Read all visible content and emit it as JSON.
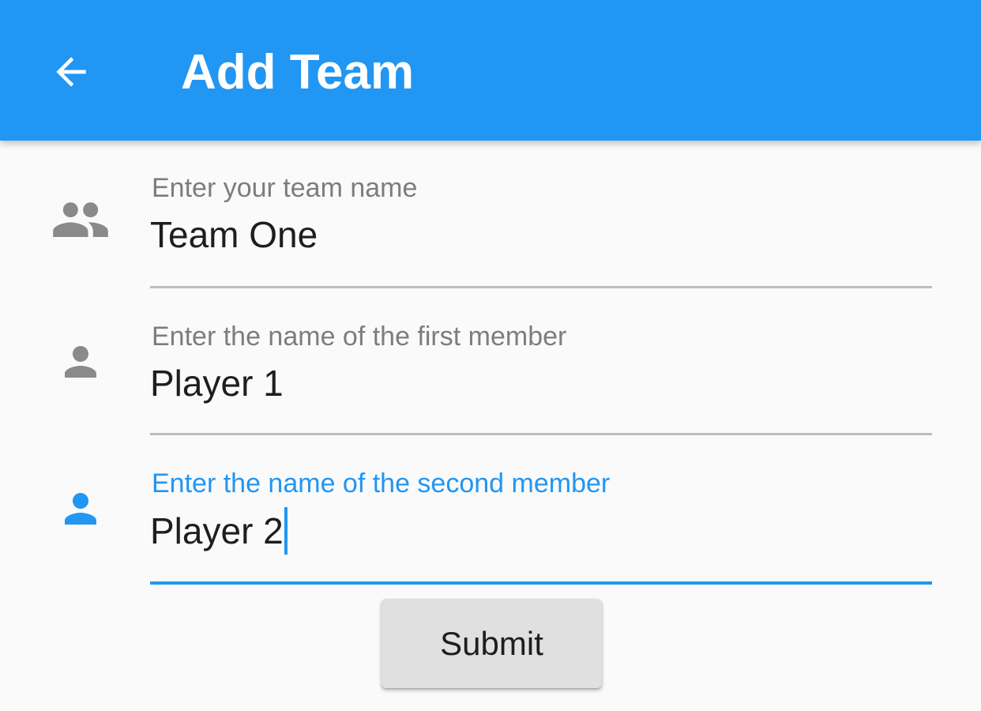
{
  "appbar": {
    "title": "Add Team",
    "back_icon": "arrow-back-icon",
    "color": "#2196f3"
  },
  "form": {
    "fields": [
      {
        "icon": "group-icon",
        "label": "Enter your team name",
        "value": "Team One",
        "focused": false
      },
      {
        "icon": "person-icon",
        "label": "Enter the name of the first member",
        "value": "Player 1",
        "focused": false
      },
      {
        "icon": "person-icon",
        "label": "Enter the name of the second member",
        "value": "Player 2",
        "focused": true
      }
    ],
    "submit_label": "Submit"
  },
  "colors": {
    "accent": "#2196f3",
    "icon_inactive": "#8a8a8a",
    "label_inactive": "#7d7d7d",
    "underline_inactive": "#bdbdbd",
    "background": "#fafafa"
  }
}
